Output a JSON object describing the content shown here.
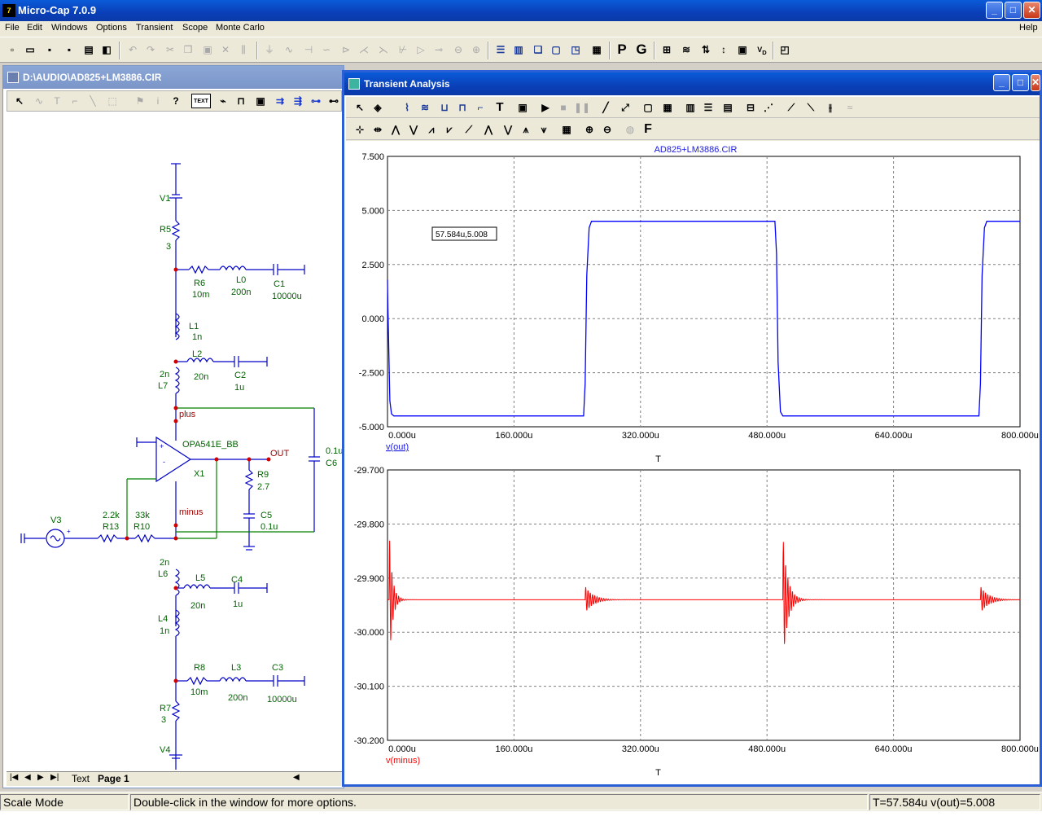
{
  "app": {
    "title": "Micro-Cap 7.0.9",
    "icon_text": "7"
  },
  "window_controls": {
    "minimize": "_",
    "maximize": "□",
    "close": "✕"
  },
  "menu": {
    "items": [
      "File",
      "Edit",
      "Windows",
      "Options",
      "Transient",
      "Scope",
      "Monte Carlo"
    ],
    "help": "Help"
  },
  "main_toolbar": {
    "icons": [
      "new-icon",
      "open-icon",
      "save-icon",
      "save-all-icon",
      "print-icon",
      "print-preview-icon",
      "undo-icon",
      "redo-icon",
      "cut-icon",
      "copy-icon",
      "paste-icon",
      "delete-icon",
      "tile-horizontal-icon",
      "tile-vertical-icon",
      "cascade-icon",
      "window-icon",
      "window-icon",
      "calculator-icon",
      "probe-icon",
      "grid-icon"
    ],
    "p_label": "P",
    "g_label": "G"
  },
  "schematic_window": {
    "title": "D:\\AUDIO\\AD825+LM3886.CIR",
    "text_tool": "TEXT",
    "tabs": {
      "text": "Text",
      "page": "Page 1"
    },
    "labels": [
      {
        "id": "v1",
        "text": "V1"
      },
      {
        "id": "r5",
        "text": "R5"
      },
      {
        "id": "r5v",
        "text": "3"
      },
      {
        "id": "r6",
        "text": "R6"
      },
      {
        "id": "r6v",
        "text": "10m"
      },
      {
        "id": "l0",
        "text": "L0"
      },
      {
        "id": "l0v",
        "text": "200n"
      },
      {
        "id": "c1",
        "text": "C1"
      },
      {
        "id": "c1v",
        "text": "10000u"
      },
      {
        "id": "l1",
        "text": "L1"
      },
      {
        "id": "l1v",
        "text": "1n"
      },
      {
        "id": "l2",
        "text": "L2"
      },
      {
        "id": "l2v",
        "text": "20n"
      },
      {
        "id": "c2",
        "text": "C2"
      },
      {
        "id": "c2v",
        "text": "1u"
      },
      {
        "id": "l7v",
        "text": "2n"
      },
      {
        "id": "l7",
        "text": "L7"
      },
      {
        "id": "plus",
        "text": "plus"
      },
      {
        "id": "opa",
        "text": "OPA541E_BB"
      },
      {
        "id": "x1",
        "text": "X1"
      },
      {
        "id": "out",
        "text": "OUT"
      },
      {
        "id": "c6v",
        "text": "0.1u"
      },
      {
        "id": "c6",
        "text": "C6"
      },
      {
        "id": "r9",
        "text": "R9"
      },
      {
        "id": "r9v",
        "text": "2.7"
      },
      {
        "id": "c5",
        "text": "C5"
      },
      {
        "id": "c5v",
        "text": "0.1u"
      },
      {
        "id": "minus",
        "text": "minus"
      },
      {
        "id": "v3",
        "text": "V3"
      },
      {
        "id": "r13v",
        "text": "2.2k"
      },
      {
        "id": "r13",
        "text": "R13"
      },
      {
        "id": "r10v",
        "text": "33k"
      },
      {
        "id": "r10",
        "text": "R10"
      },
      {
        "id": "l6v",
        "text": "2n"
      },
      {
        "id": "l6",
        "text": "L6"
      },
      {
        "id": "l5",
        "text": "L5"
      },
      {
        "id": "l5v",
        "text": "20n"
      },
      {
        "id": "c4",
        "text": "C4"
      },
      {
        "id": "c4v",
        "text": "1u"
      },
      {
        "id": "l4",
        "text": "L4"
      },
      {
        "id": "l4v",
        "text": "1n"
      },
      {
        "id": "r8",
        "text": "R8"
      },
      {
        "id": "r8v",
        "text": "10m"
      },
      {
        "id": "l3",
        "text": "L3"
      },
      {
        "id": "l3v",
        "text": "200n"
      },
      {
        "id": "c3",
        "text": "C3"
      },
      {
        "id": "c3v",
        "text": "10000u"
      },
      {
        "id": "r7",
        "text": "R7"
      },
      {
        "id": "r7v",
        "text": "3"
      },
      {
        "id": "v4",
        "text": "V4"
      }
    ]
  },
  "transient_window": {
    "title": "Transient Analysis",
    "f_label": "F",
    "t_label": "T"
  },
  "chart_data": [
    {
      "type": "line",
      "title": "AD825+LM3886.CIR",
      "xlabel": "T",
      "ylabel": "v(out)",
      "xlim": [
        0,
        800
      ],
      "ylim": [
        -5.0,
        7.5
      ],
      "x_ticks": [
        "0.000u",
        "160.000u",
        "320.000u",
        "480.000u",
        "640.000u",
        "800.000u"
      ],
      "y_ticks": [
        "7.500",
        "5.000",
        "2.500",
        "0.000",
        "-2.500",
        "-5.000"
      ],
      "grid": true,
      "color": "#0000ff",
      "cursor_label": "57.584u,5.008",
      "series": [
        {
          "name": "v(out)",
          "x": [
            0,
            0.5,
            3,
            5,
            8,
            248,
            250,
            252,
            255,
            258,
            490,
            492,
            494,
            497,
            500,
            748,
            750,
            752,
            755,
            758,
            800
          ],
          "y": [
            1.8,
            0.5,
            -3.8,
            -4.4,
            -4.5,
            -4.5,
            -3.0,
            2.0,
            4.2,
            4.5,
            4.5,
            3.0,
            -2.0,
            -4.3,
            -4.5,
            -4.5,
            -3.0,
            2.0,
            4.2,
            4.5,
            4.5
          ]
        }
      ]
    },
    {
      "type": "line",
      "xlabel": "T",
      "ylabel": "v(minus)",
      "xlim": [
        0,
        800
      ],
      "ylim": [
        -30.2,
        -29.7
      ],
      "x_ticks": [
        "0.000u",
        "160.000u",
        "320.000u",
        "480.000u",
        "640.000u",
        "800.000u"
      ],
      "y_ticks": [
        "-29.700",
        "-29.800",
        "-29.900",
        "-30.000",
        "-30.100",
        "-30.200"
      ],
      "grid": true,
      "color": "#ff0000",
      "series": [
        {
          "name": "v(minus)",
          "baseline": -29.94,
          "transients": [
            {
              "t": 2,
              "amp": 0.13,
              "decay": 4
            },
            {
              "t": 250,
              "amp": 0.025,
              "decay": 10
            },
            {
              "t": 500,
              "amp": 0.12,
              "decay": 6
            },
            {
              "t": 750,
              "amp": 0.025,
              "decay": 10
            }
          ]
        }
      ]
    }
  ],
  "status": {
    "mode": "Scale Mode",
    "hint": "Double-click in the window for more options.",
    "readout": "T=57.584u v(out)=5.008"
  }
}
